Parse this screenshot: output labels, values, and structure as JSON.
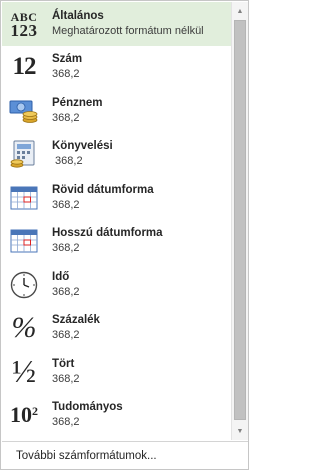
{
  "items": [
    {
      "name": "Általános",
      "sample": "Meghatározott formátum nélkül",
      "icon": "abc-123-icon"
    },
    {
      "name": "Szám",
      "sample": "368,2",
      "icon": "number-12-icon"
    },
    {
      "name": "Pénznem",
      "sample": "368,2",
      "icon": "currency-icon"
    },
    {
      "name": "Könyvelési",
      "sample": " 368,2",
      "icon": "accounting-icon"
    },
    {
      "name": "Rövid dátumforma",
      "sample": "368,2",
      "icon": "short-date-calendar-icon"
    },
    {
      "name": "Hosszú dátumforma",
      "sample": "368,2",
      "icon": "long-date-calendar-icon"
    },
    {
      "name": "Idő",
      "sample": "368,2",
      "icon": "clock-icon"
    },
    {
      "name": "Százalék",
      "sample": "368,2",
      "icon": "percent-icon"
    },
    {
      "name": "Tört",
      "sample": "368,2",
      "icon": "fraction-icon"
    },
    {
      "name": "Tudományos",
      "sample": "368,2",
      "icon": "scientific-icon"
    }
  ],
  "icon_text": {
    "abc": "ABC",
    "n123": "123",
    "twelve": "12",
    "percent": "%",
    "fraction": "½",
    "sci_base": "10",
    "sci_exp": "2"
  },
  "footer": {
    "label": "További számformátumok..."
  },
  "colors": {
    "selected_bg": "#e1eedc",
    "accent_blue": "#3a73c4",
    "coin_gold": "#d9a52a"
  }
}
